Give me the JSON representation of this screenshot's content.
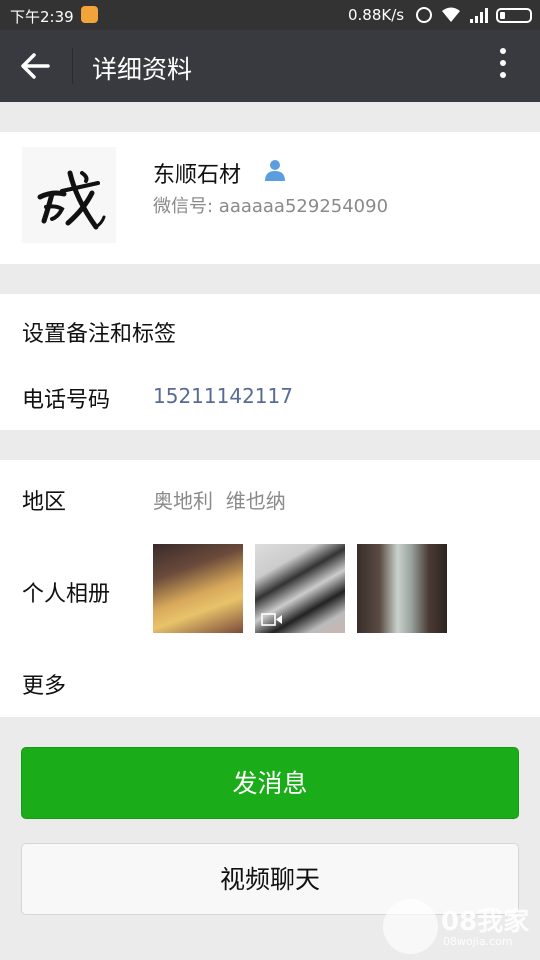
{
  "status_bar": {
    "time": "下午2:39",
    "network_speed": "0.88K/s"
  },
  "header": {
    "title": "详细资料",
    "back_icon": "arrow-left-icon",
    "menu_icon": "more-vertical-icon"
  },
  "profile": {
    "name": "东顺石材",
    "wechat_id": "微信号: aaaaaa529254090"
  },
  "info": {
    "remark_label": "设置备注和标签",
    "phone_label": "电话号码",
    "phone_value": "15211142117",
    "region_label": "地区",
    "region_value": "奥地利  维也纳",
    "album_label": "个人相册",
    "more_label": "更多"
  },
  "actions": {
    "message_label": "发消息",
    "video_call_label": "视频聊天"
  },
  "watermark": {
    "text": "08我家",
    "sub": "08wojia.com"
  },
  "colors": {
    "primary_green": "#1aad19",
    "header_bg": "#393a3f",
    "link_blue": "#576b95"
  }
}
